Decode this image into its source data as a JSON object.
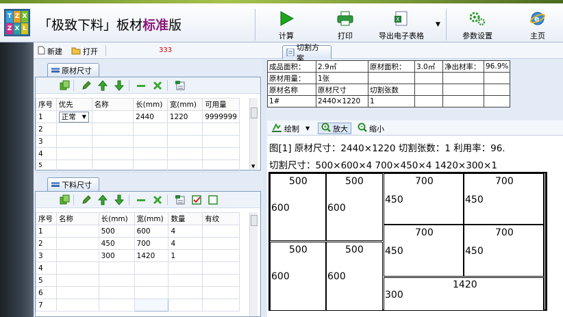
{
  "app": {
    "title_quote_open": "「",
    "title_main": "极致下料",
    "title_quote_close": "」",
    "title_board": "板材",
    "title_std": "标准",
    "title_edition": "版",
    "logo_letters": [
      "T",
      "Z",
      "X",
      "Z",
      "X",
      "L"
    ]
  },
  "toolbar": {
    "calc": "计算",
    "print": "打印",
    "export": "导出电子表格",
    "settings": "参数设置",
    "home": "主页"
  },
  "menubar": {
    "new": "新建",
    "open": "打开",
    "count": "333"
  },
  "raw_panel": {
    "tab": "原材尺寸",
    "headers": [
      "序号",
      "优先",
      "名称",
      "长(mm)",
      "宽(mm)",
      "可用量"
    ],
    "rows": [
      {
        "no": "1",
        "priority": "正常",
        "name": "",
        "length": "2440",
        "width": "1220",
        "qty": "9999999"
      },
      {
        "no": "2"
      },
      {
        "no": "3"
      },
      {
        "no": "4"
      },
      {
        "no": "5"
      }
    ]
  },
  "cut_panel": {
    "tab": "下料尺寸",
    "headers": [
      "序号",
      "名称",
      "长(mm)",
      "宽(mm)",
      "数量",
      "有纹"
    ],
    "rows": [
      {
        "no": "1",
        "length": "500",
        "width": "600",
        "qty": "4"
      },
      {
        "no": "2",
        "length": "450",
        "width": "700",
        "qty": "4"
      },
      {
        "no": "3",
        "length": "300",
        "width": "1420",
        "qty": "1"
      },
      {
        "no": "4"
      },
      {
        "no": "5"
      },
      {
        "no": "6"
      },
      {
        "no": "7"
      }
    ]
  },
  "plan": {
    "tab": "切割方案",
    "info": {
      "product_area_label": "成品面积：",
      "product_area": "2.9㎡",
      "raw_area_label": "原材面积：",
      "raw_area": "3.0㎡",
      "yield_label": "净出材率：",
      "yield": "96.9%",
      "raw_used_label": "原材用量：",
      "raw_used": "1张",
      "col_name": "原材名称",
      "col_size": "原材尺寸",
      "col_count": "切割张数",
      "row_name": "1#",
      "row_size": "2440×1220",
      "row_count": "1"
    },
    "draw_btn": "绘制",
    "zoom_in": "放大",
    "zoom_out": "缩小",
    "desc_line1": "图[1] 原材尺寸：2440×1220   切割张数：1   利用率：96.",
    "desc_line2": "切割尺寸：500×600×4  700×450×4  1420×300×1",
    "pieces": [
      {
        "w": "500",
        "h": "600"
      },
      {
        "w": "500",
        "h": "600"
      },
      {
        "w": "500",
        "h": "600"
      },
      {
        "w": "500",
        "h": "600"
      },
      {
        "w": "700",
        "h": "450"
      },
      {
        "w": "700",
        "h": "450"
      },
      {
        "w": "700",
        "h": "450"
      },
      {
        "w": "700",
        "h": "450"
      },
      {
        "w": "1420",
        "h": "300"
      }
    ]
  },
  "colors": {
    "accent_title": "#8b1a7a",
    "count_red": "#cc0000",
    "calc_green": "#1fa31f"
  },
  "icons": [
    "new-file-icon",
    "open-folder-icon",
    "play-icon",
    "printer-icon",
    "excel-export-icon",
    "gears-icon",
    "ie-globe-icon",
    "copy-icon",
    "pencil-icon",
    "arrow-up-icon",
    "arrow-down-icon",
    "minus-icon",
    "close-x-icon",
    "import-icon",
    "checkbox-checked-icon",
    "checkbox-empty-icon",
    "draw-icon",
    "zoom-in-icon",
    "zoom-out-icon"
  ]
}
